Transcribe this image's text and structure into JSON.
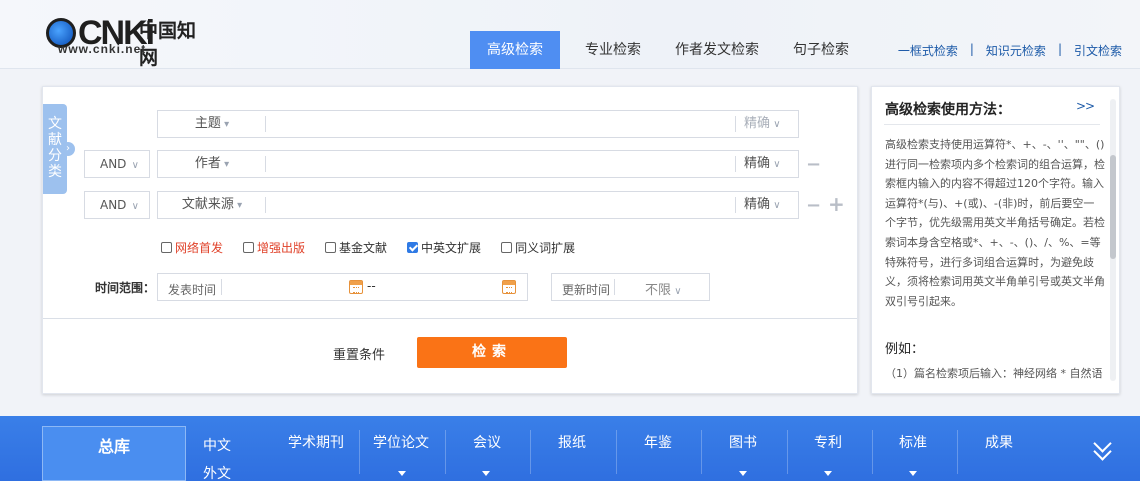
{
  "logo": {
    "brand": "CNKi",
    "chinese_name": "中国知网",
    "url_text": "www.cnki.net"
  },
  "tabs": [
    {
      "label": "高级检索",
      "active": true
    },
    {
      "label": "专业检索"
    },
    {
      "label": "作者发文检索"
    },
    {
      "label": "句子检索"
    }
  ],
  "quick_links": [
    {
      "label": "一框式检索"
    },
    {
      "label": "知识元检索"
    },
    {
      "label": "引文检索"
    }
  ],
  "side_tag": {
    "label": "文献分类",
    "arrow": "›"
  },
  "search_rows": [
    {
      "operator": "",
      "field": "主题",
      "value": "",
      "match": "精确"
    },
    {
      "operator": "AND",
      "field": "作者",
      "value": "",
      "match": "精确"
    },
    {
      "operator": "AND",
      "field": "文献来源",
      "value": "",
      "match": "精确"
    }
  ],
  "row_controls": {
    "minus": "−",
    "plus": "+"
  },
  "checkboxes": [
    {
      "label": "网络首发",
      "checked": false,
      "highlight": true
    },
    {
      "label": "增强出版",
      "checked": false,
      "highlight": true
    },
    {
      "label": "基金文献",
      "checked": false
    },
    {
      "label": "中英文扩展",
      "checked": true
    },
    {
      "label": "同义词扩展",
      "checked": false
    }
  ],
  "time_range": {
    "label": "时间范围：",
    "publish_label": "发表时间",
    "range_separator": "--",
    "update_label": "更新时间",
    "update_value": "不限"
  },
  "actions": {
    "reset": "重置条件",
    "search": "检索"
  },
  "help": {
    "title": "高级检索使用方法：",
    "more": ">>",
    "body": "高级检索支持使用运算符*、+、-、''、\"\"、()进行同一检索项内多个检索词的组合运算，检索框内输入的内容不得超过120个字符。输入运算符*(与)、+(或)、-(非)时，前后要空一个字节，优先级需用英文半角括号确定。若检索词本身含空格或*、+、-、()、/、%、=等特殊符号，进行多词组合运算时，为避免歧义，须将检索词用英文半角单引号或英文半角双引号引起来。",
    "example_title": "例如：",
    "example_1": "（1）篇名检索项后输入：神经网络 * 自然语"
  },
  "databases": {
    "all": "总库",
    "chinese": "中文",
    "foreign": "外文",
    "items": [
      {
        "label": "学术期刊",
        "has_sub": false
      },
      {
        "label": "学位论文",
        "has_sub": true
      },
      {
        "label": "会议",
        "has_sub": true
      },
      {
        "label": "报纸",
        "has_sub": false
      },
      {
        "label": "年鉴",
        "has_sub": false
      },
      {
        "label": "图书",
        "has_sub": true
      },
      {
        "label": "专利",
        "has_sub": true
      },
      {
        "label": "标准",
        "has_sub": true
      },
      {
        "label": "成果",
        "has_sub": false
      }
    ]
  },
  "colors": {
    "tab_active": "#4f8ef2",
    "search_button": "#fa7316",
    "db_bar": "#2f6fe0",
    "link": "#1c5aa8",
    "highlight_text": "#e0422a"
  }
}
